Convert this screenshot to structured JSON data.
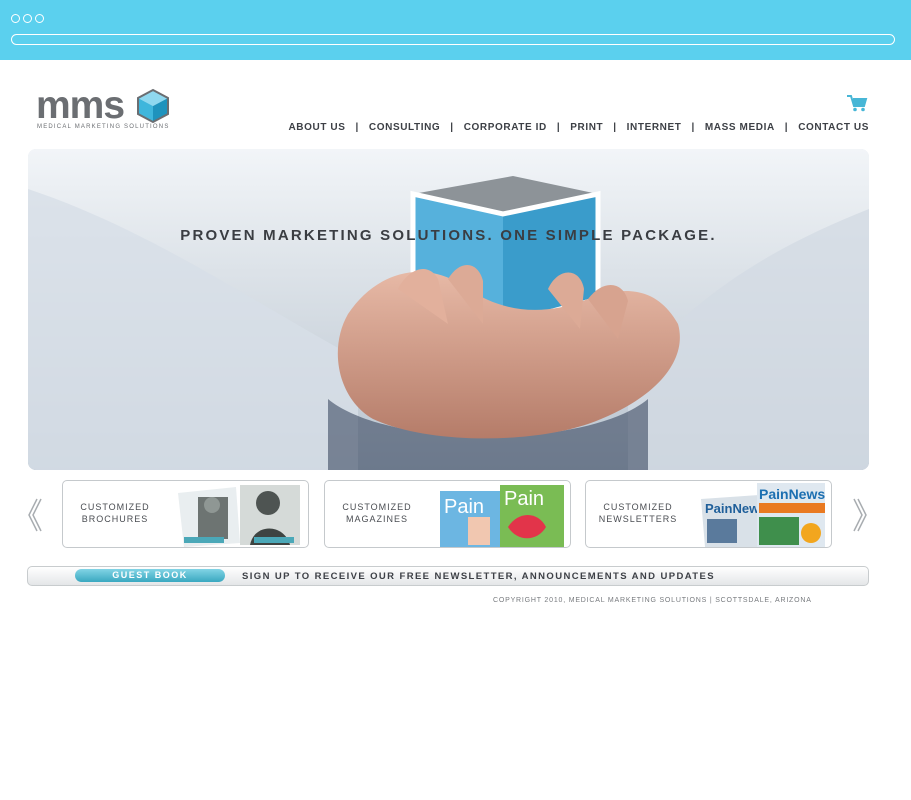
{
  "browser": {
    "title": ""
  },
  "logo": {
    "text": "mms",
    "subtitle": "MEDICAL MARKETING SOLUTIONS"
  },
  "nav": {
    "items": [
      "ABOUT US",
      "CONSULTING",
      "CORPORATE ID",
      "PRINT",
      "INTERNET",
      "MASS MEDIA",
      "CONTACT US"
    ]
  },
  "hero": {
    "headline": "PROVEN MARKETING SOLUTIONS. ONE SIMPLE PACKAGE."
  },
  "carousel": {
    "cards": [
      {
        "line1": "CUSTOMIZED",
        "line2": "BROCHURES"
      },
      {
        "line1": "CUSTOMIZED",
        "line2": "MAGAZINES"
      },
      {
        "line1": "CUSTOMIZED",
        "line2": "NEWSLETTERS"
      }
    ]
  },
  "guestbook": {
    "button": "GUEST BOOK",
    "text": "SIGN UP TO RECEIVE OUR FREE NEWSLETTER, ANNOUNCEMENTS AND UPDATES"
  },
  "footer": {
    "copyright": "COPYRIGHT 2010, MEDICAL MARKETING SOLUTIONS | SCOTTSDALE, ARIZONA"
  },
  "thumbs": {
    "magazine_title": "Pain",
    "newsletter_title": "PainNews",
    "newsletter_title2": "PainNew"
  },
  "colors": {
    "accent": "#5bd0ee",
    "cube_blue": "#4fb0dc",
    "text": "#3d4046"
  },
  "icons": {
    "cart": "cart-icon",
    "prev": "chevron-left-icon",
    "next": "chevron-right-icon",
    "logo_cube": "cube-icon"
  }
}
